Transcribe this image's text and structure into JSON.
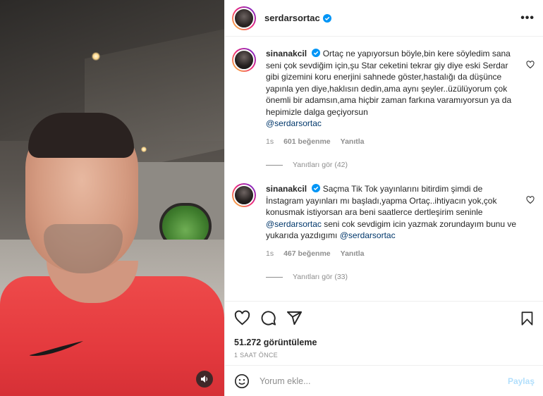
{
  "post": {
    "username": "serdarsortac",
    "more_label": "•••",
    "views": "51.272 görüntüleme",
    "time": "1 SAAT ÖNCE"
  },
  "comments": [
    {
      "username": "sinanakcil",
      "text": "Ortaç ne yapıyorsun böyle,bin kere söyledim sana seni çok sevdiğim için,şu Star ceketini tekrar giy diye eski Serdar gibi gizemini koru enerjini sahnede göster,hastalığı da düşünce yapınla yen diye,haklısın dedin,ama aynı şeyler..üzülüyorum çok önemli bir adamsın,ama hiçbir zaman farkına varamıyorsun ya da hepimizle dalga geçiyorsun",
      "mention": "@serdarsortac",
      "age": "1s",
      "likes": "601 beğenme",
      "reply_label": "Yanıtla",
      "view_replies": "Yanıtları gör (42)"
    },
    {
      "username": "sinanakcil",
      "text": "Saçma Tik Tok yayınlarını bitirdim şimdi de İnstagram yayınları mı başladı,yapma Ortaç..ihtiyacın yok,çok konusmak istiyorsan ara beni saatlerce dertleşirim seninle",
      "mention1": "@serdarsortac",
      "text2": "seni cok sevdigim icin yazmak zorundayım bunu ve yukarıda yazdıgımı",
      "mention2": "@serdarsortac",
      "age": "1s",
      "likes": "467 beğenme",
      "reply_label": "Yanıtla",
      "view_replies": "Yanıtları gör (33)"
    }
  ],
  "add_comment": {
    "placeholder": "Yorum ekle...",
    "post_label": "Paylaş"
  },
  "icons": {
    "like": "heart-icon",
    "comment": "comment-icon",
    "share": "send-icon",
    "save": "bookmark-icon",
    "emoji": "emoji-icon",
    "audio": "speaker-icon",
    "verified": "verified-badge-icon"
  },
  "colors": {
    "verified": "#0095f6",
    "mention": "#00376b",
    "muted": "#8e8e8e",
    "post_disabled": "#b2dffc"
  }
}
